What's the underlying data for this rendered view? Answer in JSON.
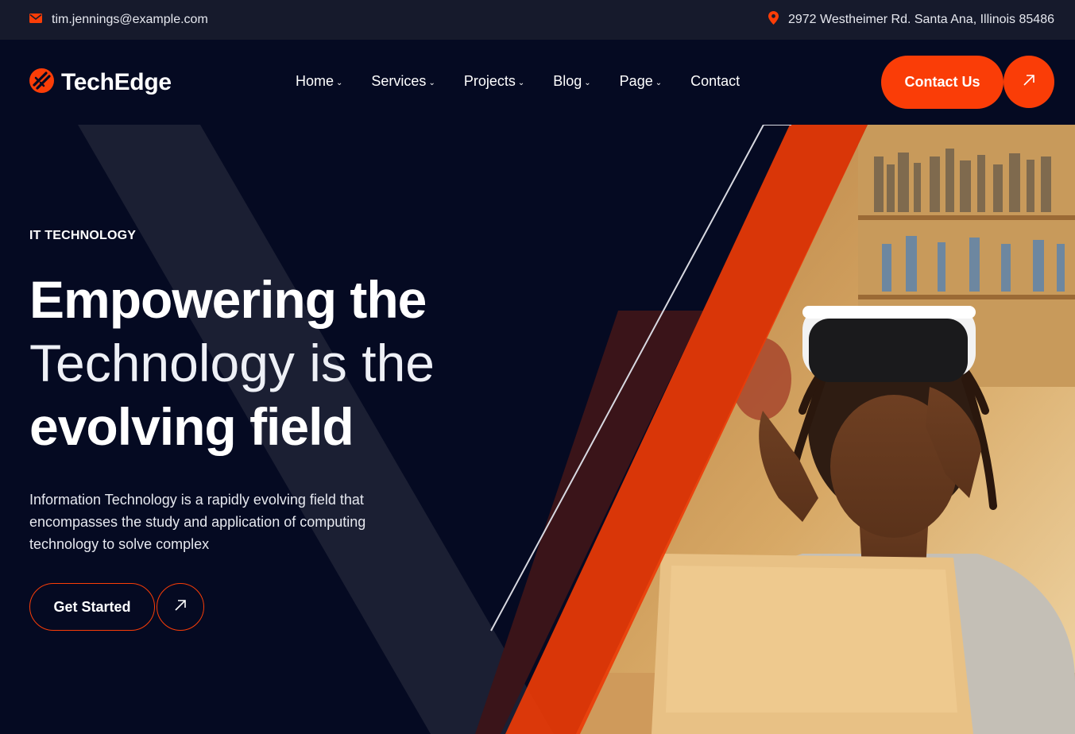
{
  "topbar": {
    "email": "tim.jennings@example.com",
    "address": "2972 Westheimer Rd. Santa Ana, Illinois 85486",
    "email_icon": "mail-icon",
    "address_icon": "map-pin-icon"
  },
  "brand": {
    "name": "TechEdge",
    "logo_icon": "logo-icon"
  },
  "nav": {
    "items": [
      {
        "label": "Home",
        "has_dropdown": true
      },
      {
        "label": "Services",
        "has_dropdown": true
      },
      {
        "label": "Projects",
        "has_dropdown": true
      },
      {
        "label": "Blog",
        "has_dropdown": true
      },
      {
        "label": "Page",
        "has_dropdown": true
      },
      {
        "label": "Contact",
        "has_dropdown": false
      }
    ],
    "contact_button": "Contact Us",
    "contact_arrow_icon": "arrow-up-right-icon"
  },
  "hero": {
    "eyebrow": "IT TECHNOLOGY",
    "headline_line1": "Empowering the",
    "headline_line2": "Technology is the",
    "headline_line3": "evolving field",
    "description": "Information Technology is a rapidly evolving field that encompasses the study and application of computing technology to solve complex",
    "cta_label": "Get Started",
    "cta_arrow_icon": "arrow-up-right-icon",
    "image": "woman-vr-headset-laptop-photo"
  },
  "colors": {
    "accent": "#fa3d07",
    "background": "#050a22",
    "topbar": "#161a2c"
  }
}
